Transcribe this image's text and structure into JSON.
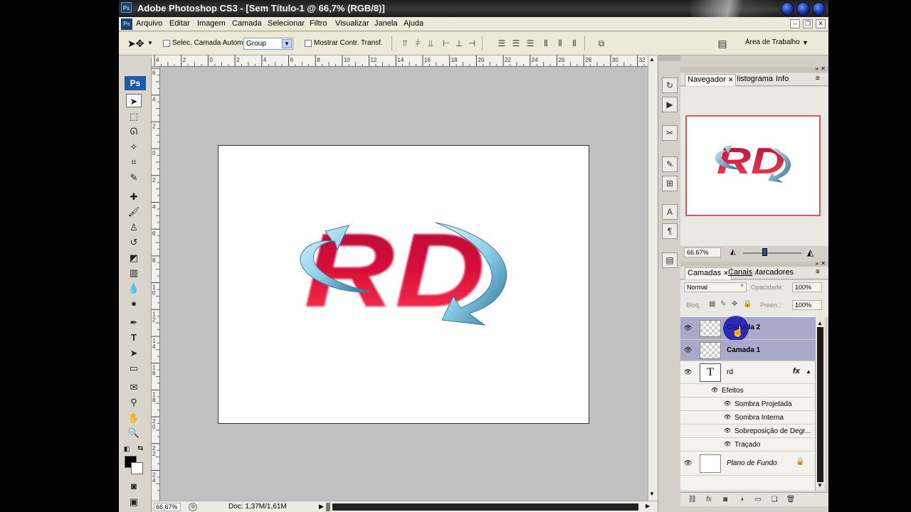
{
  "window": {
    "title": "Adobe Photoshop CS3 - [Sem Título-1 @ 66,7% (RGB/8)]",
    "app_badge": "Ps"
  },
  "menu": [
    "Arquivo",
    "Editar",
    "Imagem",
    "Camada",
    "Selecionar",
    "Filtro",
    "Visualizar",
    "Janela",
    "Ajuda"
  ],
  "options_bar": {
    "auto_select_label": "Selec. Camada Autom.",
    "auto_select_mode": "Group",
    "show_transform_label": "Mostrar Contr. Transf.",
    "workspace_label": "Área de Trabalho"
  },
  "rulers": {
    "top_ticks": [
      "4",
      "2",
      "0",
      "2",
      "4",
      "6",
      "8",
      "10",
      "12",
      "14",
      "16",
      "18",
      "20",
      "22",
      "24",
      "26",
      "28",
      "30",
      "32"
    ],
    "left_ticks": [
      "6",
      "4",
      "2",
      "0",
      "2",
      "4",
      "6",
      "8",
      "1 0",
      "1 2",
      "1 4",
      "1 6",
      "1 8",
      "2 0",
      "2 2",
      "2 4"
    ]
  },
  "canvas": {
    "artwork_text": "RD",
    "colors": {
      "logo_red": "#d8103a",
      "arrow_blue": "#8fd0ea",
      "canvas_bg": "#c0c0c0"
    }
  },
  "status_bar": {
    "zoom": "66,67%",
    "doc_info": "Doc: 1,37M/1,61M"
  },
  "navigator": {
    "tabs": [
      "Navegador",
      "Histograma",
      "Info"
    ],
    "zoom": "66.67%"
  },
  "layers_panel": {
    "tabs": [
      "Camadas",
      "Canais",
      "Marcadores"
    ],
    "blend_mode": "Normal",
    "opacity_label": "Opacidade:",
    "opacity_value": "100%",
    "lock_label": "Bloq.:",
    "fill_label": "Preen.:",
    "fill_value": "100%",
    "layers": [
      {
        "name": "Camada 2",
        "selected": true
      },
      {
        "name": "Camada 1",
        "selected": true
      },
      {
        "name": "rd",
        "type": "text",
        "thumb_glyph": "T",
        "fx": "fx"
      },
      {
        "name": "Plano de Fundo",
        "locked": true
      }
    ],
    "effects_label": "Efeitos",
    "effects": [
      "Sombra Projetada",
      "Sombra Interna",
      "Sobreposição de Degr...",
      "Traçado"
    ]
  }
}
